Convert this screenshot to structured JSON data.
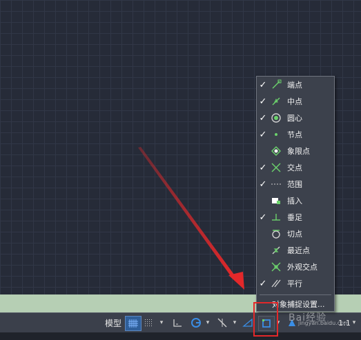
{
  "osnap_menu": {
    "items": [
      {
        "label": "端点",
        "checked": true,
        "icon": "endpoint-icon"
      },
      {
        "label": "中点",
        "checked": true,
        "icon": "midpoint-icon"
      },
      {
        "label": "圆心",
        "checked": true,
        "icon": "center-icon"
      },
      {
        "label": "节点",
        "checked": true,
        "icon": "node-icon"
      },
      {
        "label": "象限点",
        "checked": false,
        "icon": "quadrant-icon"
      },
      {
        "label": "交点",
        "checked": true,
        "icon": "intersection-icon"
      },
      {
        "label": "范围",
        "checked": true,
        "icon": "extension-icon"
      },
      {
        "label": "插入",
        "checked": false,
        "icon": "insertion-icon"
      },
      {
        "label": "垂足",
        "checked": true,
        "icon": "perpendicular-icon"
      },
      {
        "label": "切点",
        "checked": false,
        "icon": "tangent-icon"
      },
      {
        "label": "最近点",
        "checked": false,
        "icon": "nearest-icon"
      },
      {
        "label": "外观交点",
        "checked": false,
        "icon": "apparent-intersection-icon"
      },
      {
        "label": "平行",
        "checked": true,
        "icon": "parallel-icon"
      }
    ],
    "settings_label": "对象捕捉设置...",
    "check_mark": "✓"
  },
  "status_bar": {
    "model_label": "模型",
    "scale_label": "1:1",
    "arrow_glyph": "▾"
  },
  "watermark": {
    "text": "jingyan.baidu.com",
    "logo": "Bai经验"
  },
  "colors": {
    "canvas_bg": "#262b38",
    "grid_line": "#313747",
    "menu_bg": "#3c414c",
    "command_strip": "#b6cfb4",
    "annotation_red": "#e3282a",
    "status_blue": "#3a8ee6"
  }
}
